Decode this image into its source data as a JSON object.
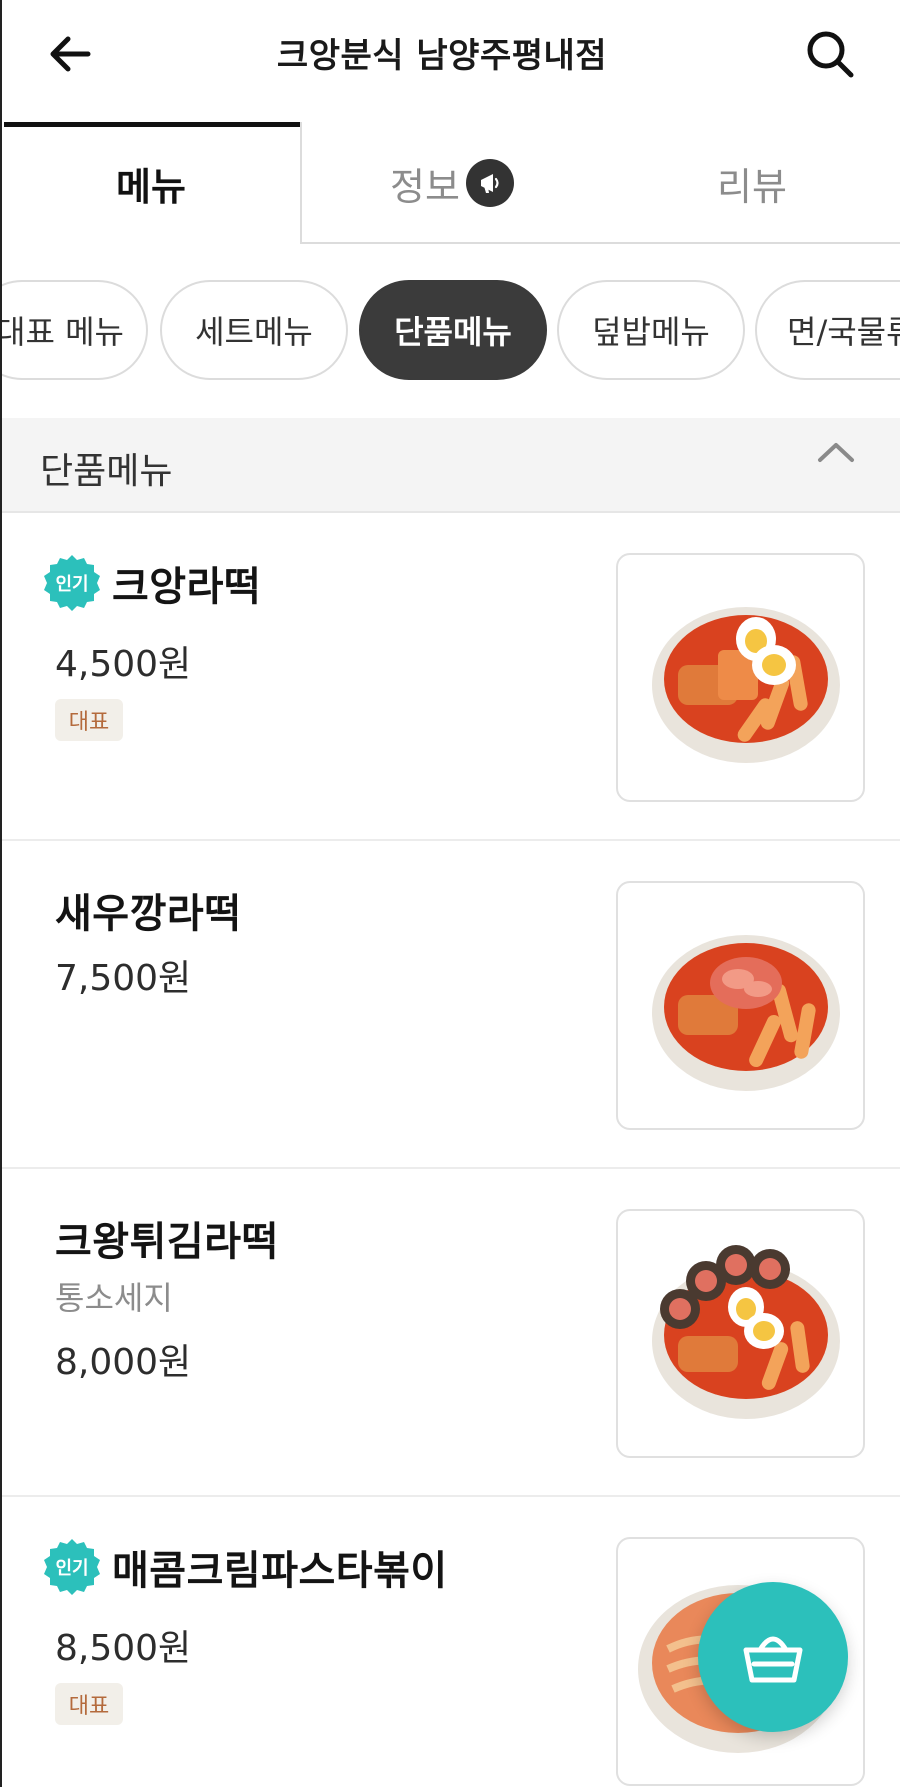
{
  "header": {
    "title": "크앙분식 남양주평내점",
    "back_icon": "arrow-left-icon",
    "search_icon": "search-icon"
  },
  "tabs": [
    {
      "label": "메뉴",
      "active": true
    },
    {
      "label": "정보",
      "active": false,
      "icon": "megaphone-icon"
    },
    {
      "label": "리뷰",
      "active": false
    }
  ],
  "chips": [
    {
      "label": "대표 메뉴",
      "active": false
    },
    {
      "label": "세트메뉴",
      "active": false
    },
    {
      "label": "단품메뉴",
      "active": true
    },
    {
      "label": "덮밥메뉴",
      "active": false
    },
    {
      "label": "면/국물류",
      "active": false
    }
  ],
  "section": {
    "title": "단품메뉴",
    "collapse_icon": "chevron-up-icon"
  },
  "items": [
    {
      "name": "크앙라떡",
      "price": "4,500원",
      "popular_label": "인기",
      "tag": "대표",
      "desc": ""
    },
    {
      "name": "새우깡라떡",
      "price": "7,500원",
      "popular_label": "",
      "tag": "",
      "desc": ""
    },
    {
      "name": "크왕튀김라떡",
      "price": "8,000원",
      "popular_label": "",
      "tag": "",
      "desc": "통소세지"
    },
    {
      "name": "매콤크림파스타볶이",
      "price": "8,500원",
      "popular_label": "인기",
      "tag": "대표",
      "desc": ""
    }
  ],
  "cart": {
    "icon": "basket-icon"
  },
  "colors": {
    "accent": "#2cc0bb",
    "chip_active": "#3b3b3b",
    "tag_text": "#b46a3c",
    "tag_bg": "#f2efe9"
  }
}
